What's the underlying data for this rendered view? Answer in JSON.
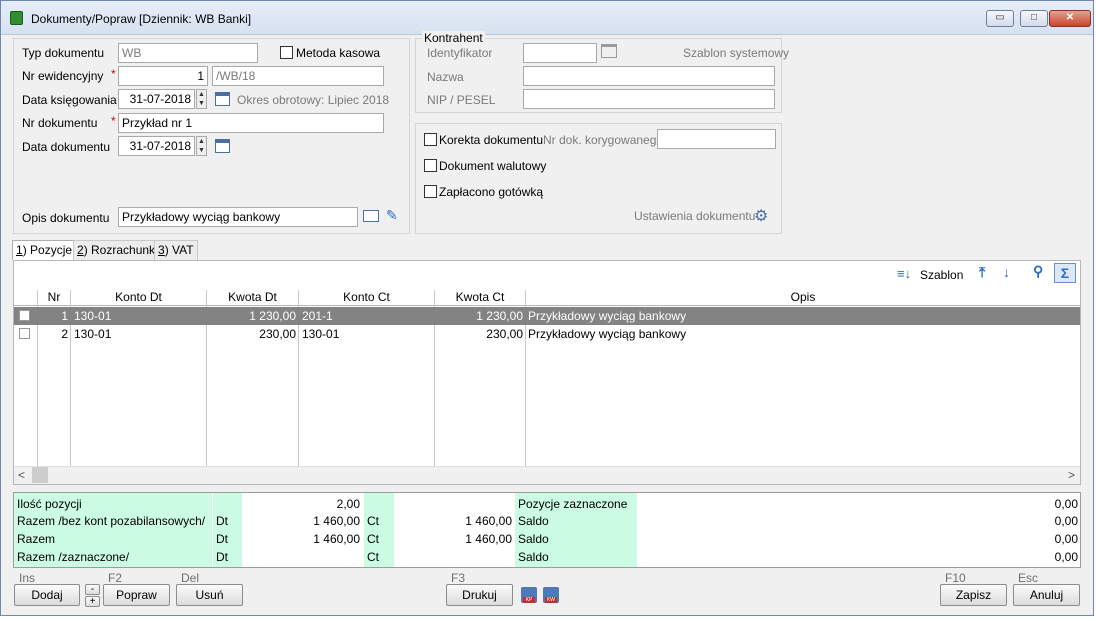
{
  "window": {
    "title": "Dokumenty/Popraw [Dziennik: WB  Banki]",
    "controls": {
      "minimize": "▭",
      "maximize": "□",
      "close": "✕"
    }
  },
  "form": {
    "typ_dokumentu_label": "Typ dokumentu",
    "typ_dokumentu_value": "WB",
    "metoda_kasowa_label": "Metoda kasowa",
    "nr_ewidencyjny_label": "Nr ewidencyjny",
    "nr_ewidencyjny_num": "1",
    "nr_ewidencyjny_suffix": "/WB/18",
    "data_ksiegowania_label": "Data księgowania",
    "data_ksiegowania_value": "31-07-2018",
    "okres_obrotowy": "Okres obrotowy: Lipiec 2018",
    "nr_dokumentu_label": "Nr dokumentu",
    "nr_dokumentu_value": "Przykład nr 1",
    "data_dokumentu_label": "Data dokumentu",
    "data_dokumentu_value": "31-07-2018",
    "opis_label": "Opis dokumentu",
    "opis_value": "Przykładowy wyciąg bankowy",
    "required_mark": "*"
  },
  "kontrahent": {
    "legend": "Kontrahent",
    "identyfikator_label": "Identyfikator",
    "szablon_systemowy": "Szablon systemowy",
    "nazwa_label": "Nazwa",
    "nip_label": "NIP / PESEL"
  },
  "options": {
    "korekta_label": "Korekta dokumentu",
    "nr_dok_korygowanego_label": "Nr dok. korygowanego",
    "walutowy_label": "Dokument walutowy",
    "zaplacono_label": "Zapłacono gotówką",
    "ustawienia_label": "Ustawienia dokumentu"
  },
  "tabs": [
    {
      "key": "1",
      "rest": ") Pozycje"
    },
    {
      "key": "2",
      "rest": ") Rozrachunki"
    },
    {
      "key": "3",
      "rest": ") VAT"
    }
  ],
  "toolbar": {
    "szablon_label": "Szablon"
  },
  "table": {
    "headers": {
      "nr": "Nr",
      "konto_dt": "Konto Dt",
      "kwota_dt": "Kwota Dt",
      "konto_ct": "Konto Ct",
      "kwota_ct": "Kwota Ct",
      "opis": "Opis"
    },
    "rows": [
      {
        "nr": "1",
        "konto_dt": "130-01",
        "kwota_dt": "1 230,00",
        "konto_ct": "201-1",
        "kwota_ct": "1 230,00",
        "opis": "Przykładowy wyciąg bankowy"
      },
      {
        "nr": "2",
        "konto_dt": "130-01",
        "kwota_dt": "230,00",
        "konto_ct": "130-01",
        "kwota_ct": "230,00",
        "opis": "Przykładowy wyciąg bankowy"
      }
    ]
  },
  "summary": {
    "rows": [
      {
        "label": "Ilość pozycji",
        "dt": "",
        "dt_val": "2,00",
        "ct": "",
        "ct_val": "",
        "right_label": "Pozycje zaznaczone",
        "right_val": "0,00"
      },
      {
        "label": "Razem /bez kont pozabilansowych/",
        "dt": "Dt",
        "dt_val": "1 460,00",
        "ct": "Ct",
        "ct_val": "1 460,00",
        "right_label": "Saldo",
        "right_val": "0,00"
      },
      {
        "label": "Razem",
        "dt": "Dt",
        "dt_val": "1 460,00",
        "ct": "Ct",
        "ct_val": "1 460,00",
        "right_label": "Saldo",
        "right_val": "0,00"
      },
      {
        "label": "Razem /zaznaczone/",
        "dt": "Dt",
        "dt_val": "",
        "ct": "Ct",
        "ct_val": "",
        "right_label": "Saldo",
        "right_val": "0,00"
      }
    ]
  },
  "buttons": {
    "ins_key": "Ins",
    "dodaj": "Dodaj",
    "f2_key": "F2",
    "popraw": "Popraw",
    "del_key": "Del",
    "usun": "Usuń",
    "f3_key": "F3",
    "drukuj": "Drukuj",
    "kp": "KP",
    "kw": "KW",
    "f10_key": "F10",
    "zapisz": "Zapisz",
    "esc_key": "Esc",
    "anuluj": "Anuluj",
    "minus": "-",
    "plus": "+"
  }
}
